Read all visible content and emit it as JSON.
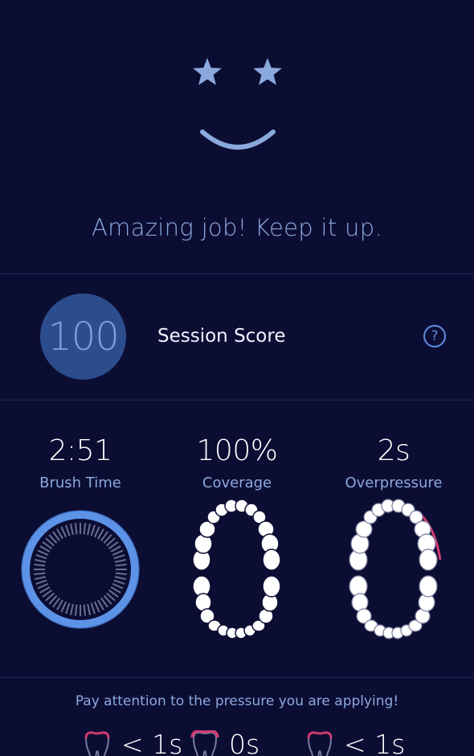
{
  "hero": {
    "message": "Amazing job! Keep it up."
  },
  "score": {
    "value": "100",
    "label": "Session Score",
    "help_label": "?"
  },
  "metrics": [
    {
      "value": "2:51",
      "label": "Brush Time",
      "icon": "timer-ring-icon"
    },
    {
      "value": "100%",
      "label": "Coverage",
      "icon": "teeth-coverage-icon"
    },
    {
      "value": "2s",
      "label": "Overpressure",
      "icon": "teeth-overpressure-icon"
    }
  ],
  "footer": {
    "message": "Pay attention to the pressure you are applying!",
    "pressure": [
      {
        "value": "< 1s",
        "icon": "tooth-icon"
      },
      {
        "value": "0s",
        "icon": "tooth-pressure-icon"
      },
      {
        "value": "< 1s",
        "icon": "tooth-icon"
      }
    ]
  },
  "colors": {
    "background": "#0c0d33",
    "accent": "#5f8ee0",
    "soft_blue": "#8aa9dd",
    "pressure_pink": "#d23a72"
  }
}
